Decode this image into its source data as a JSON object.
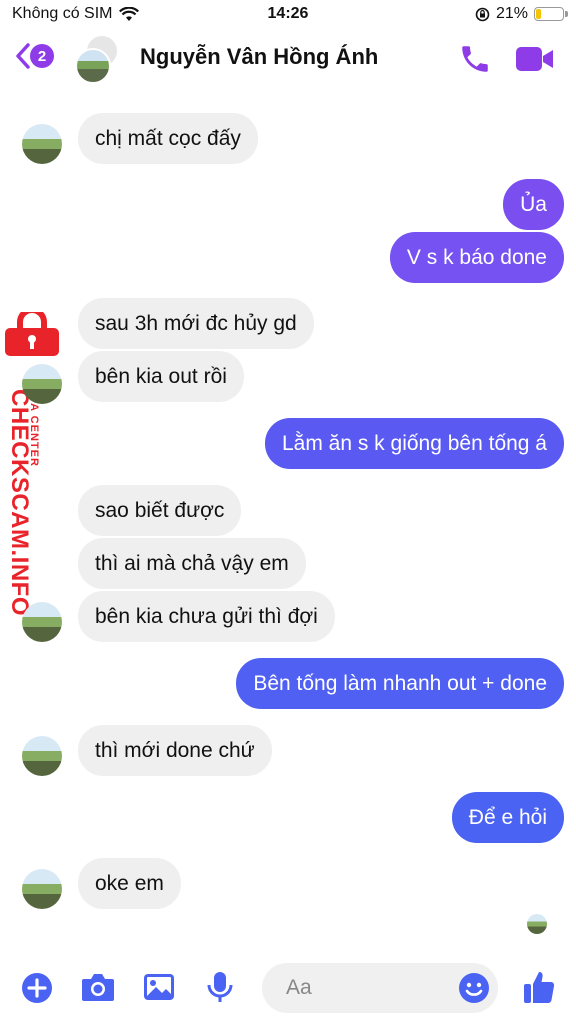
{
  "status_bar": {
    "carrier": "Không có SIM",
    "time": "14:26",
    "battery": "21%",
    "battery_level": 0.21
  },
  "header": {
    "back_count": "2",
    "contact_name": "Nguyễn Vân Hồng Ánh"
  },
  "messages": [
    {
      "dir": "in",
      "text": "chị mất cọc đấy"
    },
    {
      "dir": "out",
      "text": "Ủa"
    },
    {
      "dir": "out",
      "text": "V s k báo done"
    },
    {
      "dir": "in",
      "text": "sau 3h mới đc hủy gd"
    },
    {
      "dir": "in",
      "text": "bên kia out rồi"
    },
    {
      "dir": "out",
      "text": "Lằm ăn s k giống bên tống á"
    },
    {
      "dir": "in",
      "text": "sao biết được"
    },
    {
      "dir": "in",
      "text": "thì ai mà chả vậy em"
    },
    {
      "dir": "in",
      "text": "bên kia chưa gửi thì đợi"
    },
    {
      "dir": "out",
      "text": "Bên tống làm nhanh out + done"
    },
    {
      "dir": "in",
      "text": "thì mới done chứ"
    },
    {
      "dir": "out",
      "text": "Để e hỏi"
    },
    {
      "dir": "in",
      "text": "oke em"
    }
  ],
  "watermark": {
    "brand": "CHECKSCAM.INFO",
    "sub": "DATA CENTER"
  },
  "composer": {
    "placeholder": "Aa"
  },
  "colors": {
    "accent": "#8e3ce8",
    "bubble_purple": "#7b4ef0",
    "bubble_blue": "#4a63f2",
    "bubble_in": "#efefef",
    "watermark": "#e8232a"
  }
}
